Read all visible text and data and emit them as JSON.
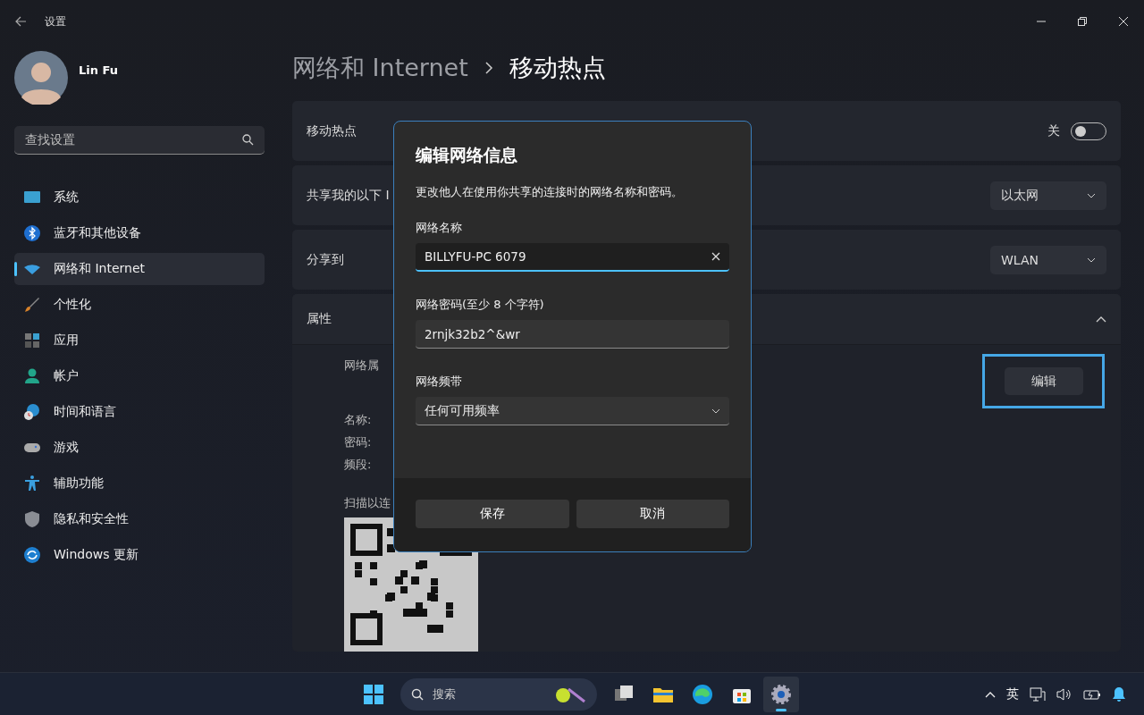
{
  "window": {
    "title": "设置"
  },
  "user": {
    "name": "Lin Fu"
  },
  "search": {
    "placeholder": "查找设置"
  },
  "nav": [
    {
      "label": "系统",
      "kind": "system",
      "selected": false
    },
    {
      "label": "蓝牙和其他设备",
      "kind": "bluetooth",
      "selected": false
    },
    {
      "label": "网络和 Internet",
      "kind": "network",
      "selected": true
    },
    {
      "label": "个性化",
      "kind": "brush",
      "selected": false
    },
    {
      "label": "应用",
      "kind": "apps",
      "selected": false
    },
    {
      "label": "帐户",
      "kind": "account",
      "selected": false
    },
    {
      "label": "时间和语言",
      "kind": "time",
      "selected": false
    },
    {
      "label": "游戏",
      "kind": "gaming",
      "selected": false
    },
    {
      "label": "辅助功能",
      "kind": "accessibility",
      "selected": false
    },
    {
      "label": "隐私和安全性",
      "kind": "privacy",
      "selected": false
    },
    {
      "label": "Windows 更新",
      "kind": "update",
      "selected": false
    }
  ],
  "breadcrumb": {
    "parent": "网络和 Internet",
    "current": "移动热点"
  },
  "settings": [
    {
      "kind": "toggle",
      "label": "移动热点",
      "state_label": "关",
      "on": false
    },
    {
      "kind": "dropdown",
      "label": "共享我的以下 I",
      "value": "以太网"
    },
    {
      "kind": "dropdown",
      "label": "分享到",
      "value": "WLAN"
    }
  ],
  "properties": {
    "title": "属性",
    "expanded": true,
    "section_label": "网络属",
    "edit_button": "编辑",
    "edit_highlighted": true,
    "fields": [
      "名称:",
      "密码:",
      "频段:"
    ],
    "qr_label": "扫描以连"
  },
  "dialog": {
    "title": "编辑网络信息",
    "description": "更改他人在使用你共享的连接时的网络名称和密码。",
    "fields": [
      {
        "kind": "text",
        "label": "网络名称",
        "value": "BILLYFU-PC 6079",
        "focused": true
      },
      {
        "kind": "text",
        "label": "网络密码(至少 8 个字符)",
        "value": "2rnjk32b2^&wr",
        "focused": false
      },
      {
        "kind": "select",
        "label": "网络频带",
        "value": "任何可用频率"
      }
    ],
    "buttons": [
      "保存",
      "取消"
    ]
  },
  "taskbar": {
    "search_placeholder": "搜索",
    "apps": [
      {
        "kind": "taskview",
        "active": false
      },
      {
        "kind": "files",
        "active": false
      },
      {
        "kind": "browser",
        "active": false
      },
      {
        "kind": "store",
        "active": false
      },
      {
        "kind": "settings",
        "active": true
      }
    ],
    "ime": "英"
  }
}
